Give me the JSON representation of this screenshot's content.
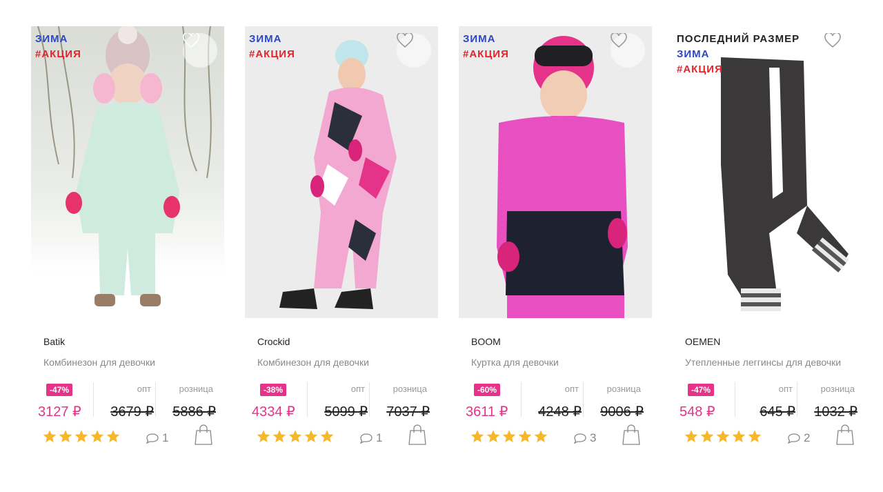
{
  "currency": "₽",
  "labels": {
    "wholesale": "опт",
    "retail": "розница"
  },
  "colors": {
    "accent_pink": "#e6338a",
    "season_blue": "#2b47c7",
    "promo_red": "#e3242b",
    "star": "#f5b82a"
  },
  "products": [
    {
      "badges": {
        "last_size": "",
        "season": "ЗИМА",
        "promo": "#АКЦИЯ"
      },
      "brand": "Batik",
      "name": "Комбинезон для девочки",
      "discount": "-47%",
      "price_current": "3127 ₽",
      "price_wholesale": "3679 ₽",
      "price_retail": "5886 ₽",
      "rating": 5,
      "comments": "1",
      "favorite_icon": "heart-icon",
      "cart_icon": "shopping-bag-icon"
    },
    {
      "badges": {
        "last_size": "",
        "season": "ЗИМА",
        "promo": "#АКЦИЯ"
      },
      "brand": "Crockid",
      "name": "Комбинезон для девочки",
      "discount": "-38%",
      "price_current": "4334 ₽",
      "price_wholesale": "5099 ₽",
      "price_retail": "7037 ₽",
      "rating": 5,
      "comments": "1",
      "favorite_icon": "heart-icon",
      "cart_icon": "shopping-bag-icon"
    },
    {
      "badges": {
        "last_size": "",
        "season": "ЗИМА",
        "promo": "#АКЦИЯ"
      },
      "brand": "BOOM",
      "name": "Куртка для девочки",
      "discount": "-60%",
      "price_current": "3611 ₽",
      "price_wholesale": "4248 ₽",
      "price_retail": "9006 ₽",
      "rating": 5,
      "comments": "3",
      "favorite_icon": "heart-icon",
      "cart_icon": "shopping-bag-icon"
    },
    {
      "badges": {
        "last_size": "ПОСЛЕДНИЙ РАЗМЕР",
        "season": "ЗИМА",
        "promo": "#АКЦИЯ"
      },
      "brand": "OEMEN",
      "name": "Утепленные леггинсы для девочки",
      "discount": "-47%",
      "price_current": "548 ₽",
      "price_wholesale": "645 ₽",
      "price_retail": "1032 ₽",
      "rating": 5,
      "comments": "2",
      "favorite_icon": "heart-icon",
      "cart_icon": "shopping-bag-icon"
    }
  ]
}
